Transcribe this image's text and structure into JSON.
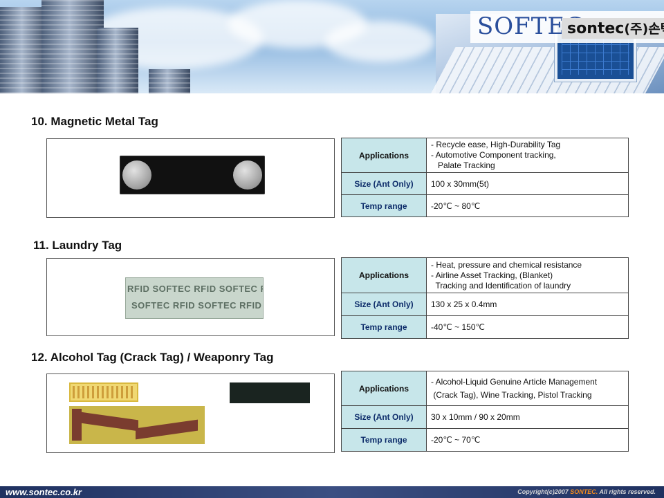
{
  "header": {
    "logo_main": "SOFTEC",
    "logo_sub": "sontec",
    "logo_sub_korean": "(주)손텍"
  },
  "sections": [
    {
      "title": "10. Magnetic Metal Tag",
      "rows": {
        "applications_label": "Applications",
        "applications_lines": [
          "- Recycle ease, High-Durability Tag",
          "- Automotive Component  tracking,",
          "   Palate Tracking"
        ],
        "size_label": "Size (Ant Only)",
        "size_value": "100 x 30mm(5t)",
        "temp_label": "Temp range",
        "temp_value": "-20℃ ~ 80℃"
      }
    },
    {
      "title": "11. Laundry Tag",
      "rows": {
        "applications_label": "Applications",
        "applications_lines": [
          "- Heat, pressure and chemical resistance",
          "- Airline Asset Tracking, (Blanket)",
          "  Tracking and Identification of laundry"
        ],
        "size_label": "Size (Ant Only)",
        "size_value": "130 x 25 x 0.4mm",
        "temp_label": "Temp range",
        "temp_value": "-40℃ ~ 150℃"
      },
      "image_text": {
        "row1": "RFID SOFTEC  RFID SOFTEC  R",
        "row2": "SOFTEC RFID  SOFTEC RFID"
      }
    },
    {
      "title": "12. Alcohol Tag (Crack Tag) / Weaponry Tag",
      "rows": {
        "applications_label": "Applications",
        "applications_lines": [
          "- Alcohol-Liquid Genuine Article Management",
          " (Crack Tag), Wine Tracking, Pistol Tracking"
        ],
        "size_label": "Size (Ant Only)",
        "size_value": "30 x 10mm / 90 x 20mm",
        "temp_label": "Temp range",
        "temp_value": "-20℃ ~ 70℃"
      }
    }
  ],
  "footer": {
    "url": "www.sontec.co.kr",
    "copyright_prefix": "Copyright(c)2007 ",
    "copyright_brand": "SONTEC.",
    "copyright_suffix": " All rights reserved."
  },
  "colors": {
    "label_bg": "#c7e6ea",
    "label_text": "#0d2c6a",
    "footer_bg": "#1f3160",
    "brand_orange": "#f28a1e"
  }
}
